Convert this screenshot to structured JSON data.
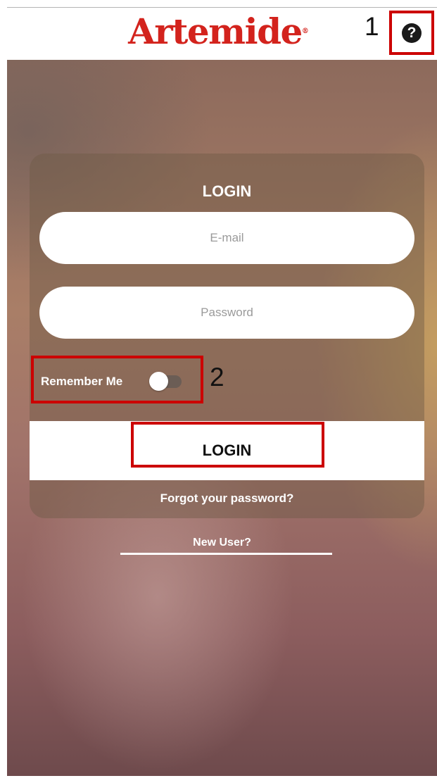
{
  "header": {
    "logo_text": "Artemide",
    "logo_mark": "®",
    "help_icon": "question-circle-icon",
    "help_glyph": "?"
  },
  "annotations": {
    "callout_1": "1",
    "callout_2": "2",
    "highlight_color": "#cc0000"
  },
  "login_form": {
    "title": "LOGIN",
    "email": {
      "placeholder": "E-mail",
      "value": ""
    },
    "password": {
      "placeholder": "Password",
      "value": ""
    },
    "remember_me": {
      "label": "Remember Me",
      "enabled": false
    },
    "login_button_label": "LOGIN",
    "forgot_password_link": "Forgot your password?"
  },
  "footer": {
    "new_user_link": "New User?"
  },
  "colors": {
    "brand_red": "#d3231d",
    "card_overlay": "rgba(110, 90, 72, 0.45)",
    "text_on_image": "#ffffff"
  }
}
